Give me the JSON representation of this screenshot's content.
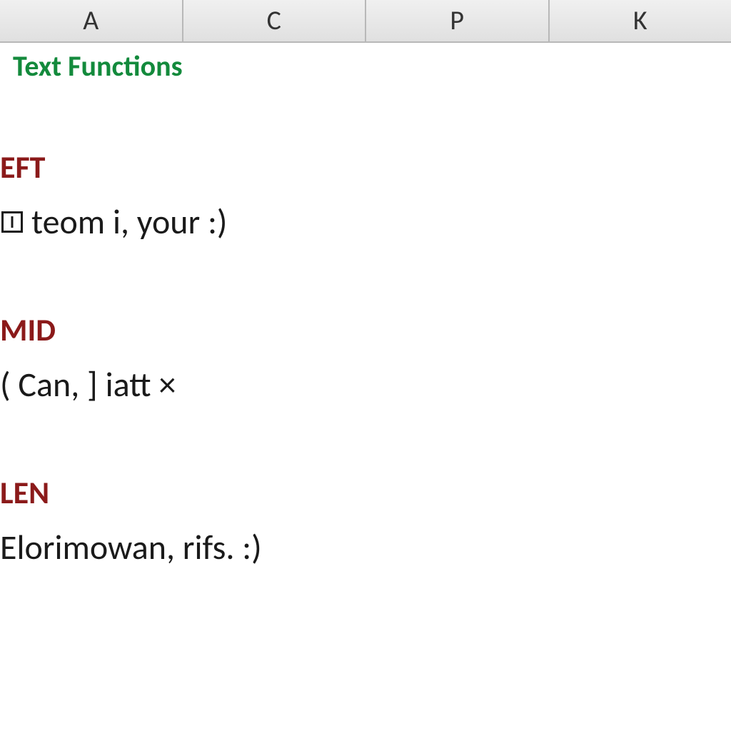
{
  "columns": {
    "col1": "A",
    "col2": "C",
    "col3": "P",
    "col4": "K"
  },
  "title": "Text Functions",
  "sections": {
    "eft": {
      "heading": "EFT",
      "text": "teom i, your :)"
    },
    "mid": {
      "heading": "MID",
      "text": "( Can, ] iatt ×"
    },
    "len": {
      "heading": "LEN",
      "text": "Elorimowan, rifs. :)"
    }
  }
}
